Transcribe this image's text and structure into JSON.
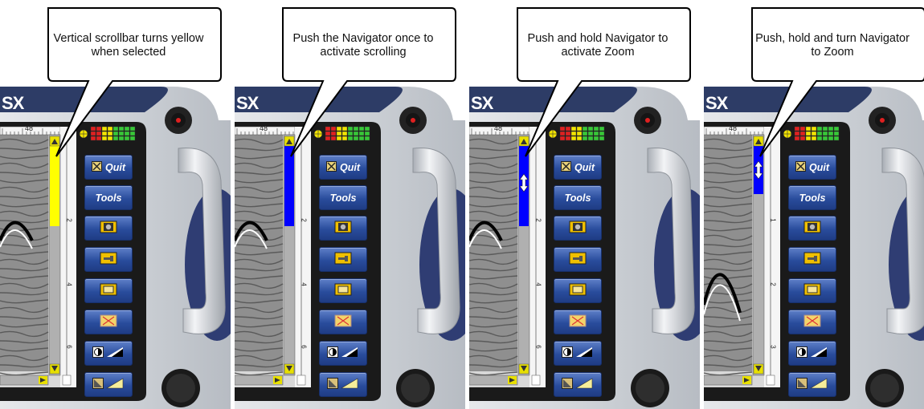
{
  "panels": [
    {
      "caption": "Vertical scrollbar turns yellow when selected",
      "scrollbar_state": "selected",
      "scrollbar_color": "#ffff00",
      "zoom_icon": false,
      "depth_labels": [
        "2",
        "4",
        "6"
      ]
    },
    {
      "caption": "Push the Navigator once to activate scrolling",
      "scrollbar_state": "scrolling",
      "scrollbar_color": "#0000ff",
      "zoom_icon": false,
      "depth_labels": [
        "2",
        "4",
        "6"
      ]
    },
    {
      "caption": "Push and hold Navigator to activate Zoom",
      "scrollbar_state": "zoom-active",
      "scrollbar_color": "#0000ff",
      "zoom_icon": true,
      "depth_labels": [
        "2",
        "4",
        "6"
      ]
    },
    {
      "caption": "Push, hold and turn Navigator to Zoom",
      "scrollbar_state": "zooming",
      "scrollbar_color": "#0000ff",
      "zoom_icon": true,
      "depth_labels": [
        "1",
        "2",
        "3"
      ]
    }
  ],
  "device": {
    "logo_fragment": "SX",
    "ruler_value": "48",
    "buttons": [
      {
        "label": "Quit",
        "icon": "quit-x-icon"
      },
      {
        "label": "Tools",
        "icon": ""
      },
      {
        "label": "",
        "icon": "camera-icon"
      },
      {
        "label": "",
        "icon": "wrench-icon"
      },
      {
        "label": "",
        "icon": "screen-frame-icon"
      },
      {
        "label": "",
        "icon": "crossed-box-icon"
      },
      {
        "label": "",
        "icon": "contrast-icon"
      },
      {
        "label": "",
        "icon": "gain-triangle-icon"
      }
    ]
  },
  "colors": {
    "button_blue": "#294c9c",
    "bezel_dark": "#1a1a1a",
    "case_silver": "#cfd3d8",
    "scroll_track": "#b0b0b0",
    "accent_red": "#e02020",
    "accent_yellow": "#f2e400",
    "accent_green": "#37c837"
  }
}
